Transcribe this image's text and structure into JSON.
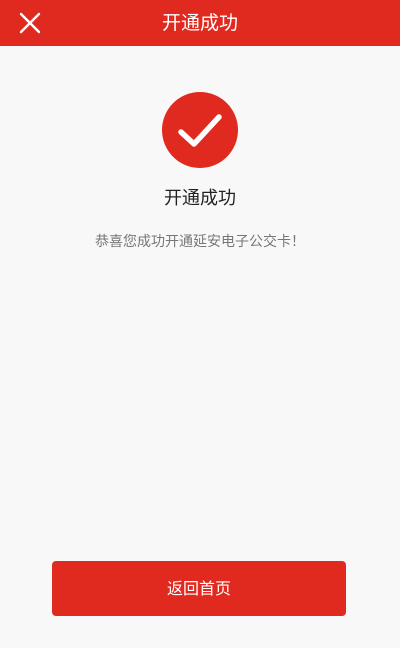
{
  "colors": {
    "accent": "#e02a20",
    "background": "#f8f8f8",
    "title_text": "#222222",
    "message_text": "#777777"
  },
  "header": {
    "title": "开通成功",
    "close_icon": "close-icon"
  },
  "result": {
    "icon": "check-icon",
    "title": "开通成功",
    "message": "恭喜您成功开通延安电子公交卡！"
  },
  "actions": {
    "home_label": "返回首页"
  }
}
